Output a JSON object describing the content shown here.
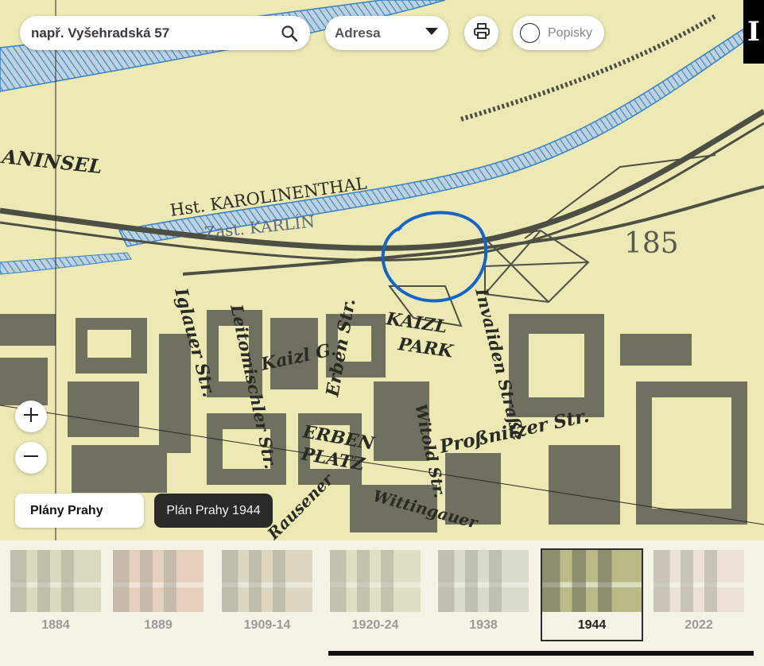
{
  "search": {
    "placeholder": "např. Vyšehradská 57"
  },
  "mode_select": {
    "value": "Adresa"
  },
  "labels_toggle": {
    "label": "Popisky"
  },
  "info_tab": {
    "label": "I"
  },
  "series_button": {
    "label": "Plány Prahy"
  },
  "current_map": {
    "label": "Plán Prahy 1944"
  },
  "timeline": {
    "items": [
      {
        "year": "1884",
        "tint": "#c8c6a0"
      },
      {
        "year": "1889",
        "tint": "#dcb49c"
      },
      {
        "year": "1909-14",
        "tint": "#c9bfa6"
      },
      {
        "year": "1920-24",
        "tint": "#d3cfa8"
      },
      {
        "year": "1938",
        "tint": "#c6cbb6"
      },
      {
        "year": "1944",
        "tint": "#b9ba86",
        "active": true
      },
      {
        "year": "2022",
        "tint": "#e4d4d0"
      }
    ]
  },
  "map": {
    "labels": {
      "island": "ANINSEL",
      "station": "Hst. KAROLINENTHAL",
      "stop": "Zast. KARLÍN",
      "number": "185",
      "kaizl_park_1": "KAIZL",
      "kaizl_park_2": "PARK",
      "kaizl_g": "Kaizl G.",
      "erben_str": "Erben Str.",
      "erben_platz_1": "ERBEN",
      "erben_platz_2": "PLATZ",
      "leitomischler": "Leitomischler Str.",
      "iglauer": "Iglauer Str.",
      "invaliden": "Invaliden Straße",
      "witold": "Witold Str.",
      "prossnitzer": "Proßnitzer Str.",
      "wittingauer": "Wittingauer",
      "rausener": "Rausener"
    },
    "river_color": "#3a80c2",
    "marker_color": "#1565c8",
    "block_color": "#6f705f"
  }
}
